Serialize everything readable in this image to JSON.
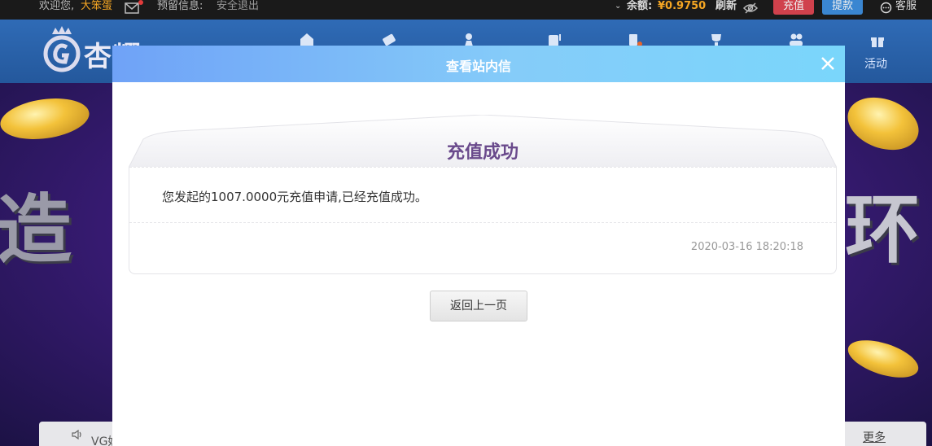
{
  "topbar": {
    "welcome": "欢迎您,",
    "username": "大笨蛋",
    "notice": "预留信息:",
    "logout": "安全退出",
    "balance_label": "余额:",
    "balance_value": "¥0.9750",
    "refresh": "刷新",
    "recharge": "充值",
    "withdraw": "提款",
    "service": "客服"
  },
  "navbar": {
    "logo_text": "杏耀",
    "activity_label": "活动"
  },
  "hero": {
    "left_chars": "造",
    "right_chars": "环"
  },
  "marquee": {
    "text": "VG娱",
    "more": "更多"
  },
  "modal": {
    "title": "查看站内信",
    "message": {
      "title": "充值成功",
      "body": "您发起的1007.0000元充值申请,已经充值成功。",
      "time": "2020-03-16 18:20:18"
    },
    "back_button": "返回上一页"
  },
  "colors": {
    "header_gradient_start": "#6fa2f7",
    "header_gradient_end": "#7ad6fb",
    "title_purple": "#6a4a8c",
    "recharge_red": "#d0414c",
    "withdraw_blue": "#3a86d1",
    "balance_gold": "#f5a623"
  }
}
